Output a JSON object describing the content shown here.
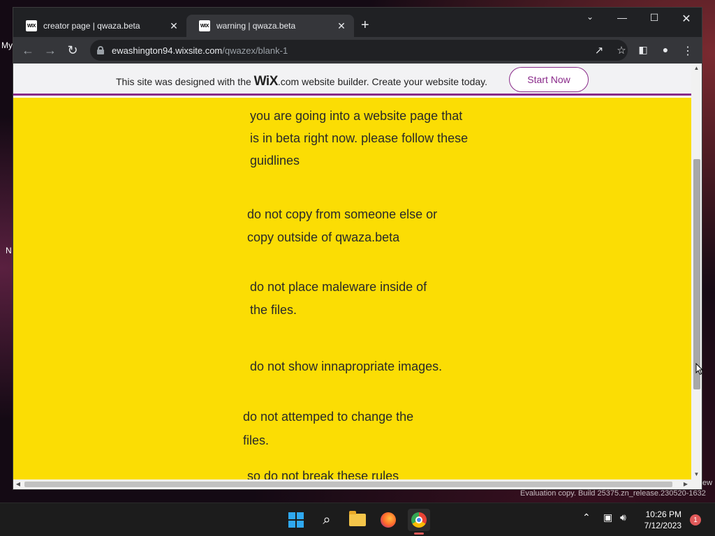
{
  "desktop": {
    "label_my": "My",
    "label_n": "N",
    "label_ew": "ew",
    "evaluation_text": "Evaluation copy. Build 25375.zn_release.230520-1632"
  },
  "browser": {
    "tabs": [
      {
        "favicon": "WIX",
        "title": "creator page | qwaza.beta",
        "close": "✕"
      },
      {
        "favicon": "WIX",
        "title": "warning | qwaza.beta",
        "close": "✕"
      }
    ],
    "new_tab": "+",
    "url_host": "ewashington94.wixsite.com",
    "url_path": "/qwazex/blank-1"
  },
  "page": {
    "banner": {
      "text_before": "This site was designed with the ",
      "wix": "WiX",
      "text_after": ".com website builder. Create your website today.",
      "button": "Start Now"
    },
    "paragraphs": [
      {
        "lines": [
          "you are going into a website page that",
          "is in beta right now. please follow these",
          "guidlines"
        ]
      },
      {
        "lines": [
          "do not copy from someone else or",
          "copy outside of qwaza.beta"
        ]
      },
      {
        "lines": [
          "do not place maleware inside of",
          "the files."
        ]
      },
      {
        "lines": [
          "do not show innapropriate images."
        ]
      },
      {
        "lines": [
          "do not attemped to change the",
          "files."
        ]
      },
      {
        "lines": [
          "so do not break these rules"
        ]
      }
    ],
    "background_color": "#fbdd04",
    "accent_color": "#8a2a8a"
  },
  "taskbar": {
    "time": "10:26 PM",
    "date": "7/12/2023",
    "notification_count": "1"
  }
}
